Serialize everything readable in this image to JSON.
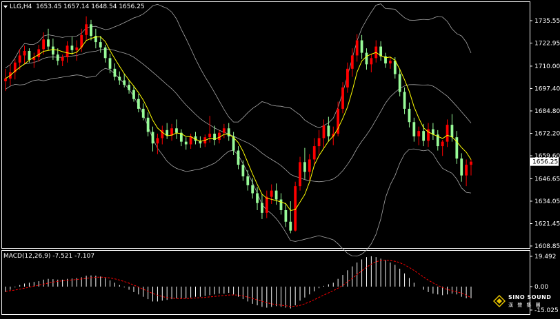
{
  "header": {
    "symbol": "LLG,H4",
    "ohlc": "1653.45 1657.14 1648.54 1656.25"
  },
  "macd_header": {
    "label": "MACD(12,26,9) -7.521 -7.107"
  },
  "price_axis": {
    "ticks": [
      "1735.55",
      "1722.95",
      "1710.00",
      "1697.40",
      "1684.80",
      "1672.20",
      "1659.60",
      "1646.65",
      "1634.05",
      "1621.45",
      "1608.85"
    ],
    "current_price": "1656.25"
  },
  "macd_axis": {
    "ticks": [
      "19.492",
      "0.00",
      "-15.025"
    ]
  },
  "logo": {
    "brand": "SINO SOUND",
    "chinese": "漢 聲 集 團"
  },
  "colors": {
    "background": "#000000",
    "bull_candle": "#ff0000",
    "bear_candle": "#98fb98",
    "ma_line": "#ffff00",
    "bands": "#a8a8a8",
    "macd_hist": "#ffffff",
    "macd_signal": "#ff0000",
    "axis_border": "#ffffff"
  },
  "chart_data": [
    {
      "type": "candlestick",
      "title": "LLG,H4",
      "indicators": [
        "Bollinger Bands",
        "Moving Average"
      ],
      "ylim": [
        1608.85,
        1741.0
      ],
      "ohlc": [
        [
          1701.5,
          1708.5,
          1696.0,
          1703.0
        ],
        [
          1703.0,
          1711.0,
          1699.0,
          1706.5
        ],
        [
          1706.5,
          1714.0,
          1702.5,
          1712.0
        ],
        [
          1712.0,
          1719.5,
          1708.0,
          1716.0
        ],
        [
          1716.0,
          1721.5,
          1711.5,
          1718.5
        ],
        [
          1718.5,
          1720.0,
          1712.0,
          1713.5
        ],
        [
          1713.5,
          1717.5,
          1709.0,
          1715.0
        ],
        [
          1715.0,
          1722.0,
          1712.5,
          1719.5
        ],
        [
          1719.5,
          1729.0,
          1716.5,
          1725.0
        ],
        [
          1725.0,
          1731.0,
          1719.0,
          1721.0
        ],
        [
          1721.0,
          1725.5,
          1713.5,
          1716.5
        ],
        [
          1716.5,
          1720.0,
          1710.5,
          1713.0
        ],
        [
          1713.0,
          1716.5,
          1710.0,
          1715.0
        ],
        [
          1715.0,
          1724.0,
          1712.0,
          1721.5
        ],
        [
          1721.5,
          1726.5,
          1716.5,
          1719.0
        ],
        [
          1719.0,
          1724.5,
          1713.0,
          1720.5
        ],
        [
          1720.5,
          1731.0,
          1718.0,
          1727.5
        ],
        [
          1727.5,
          1738.0,
          1724.5,
          1733.5
        ],
        [
          1733.5,
          1736.0,
          1724.5,
          1727.0
        ],
        [
          1727.0,
          1731.0,
          1720.0,
          1723.5
        ],
        [
          1723.5,
          1727.0,
          1717.5,
          1720.5
        ],
        [
          1720.5,
          1722.0,
          1712.0,
          1714.5
        ],
        [
          1714.5,
          1717.0,
          1706.0,
          1708.5
        ],
        [
          1708.5,
          1711.5,
          1702.0,
          1704.0
        ],
        [
          1704.0,
          1707.0,
          1699.5,
          1702.0
        ],
        [
          1702.0,
          1705.5,
          1698.0,
          1699.5
        ],
        [
          1699.5,
          1702.0,
          1694.5,
          1696.5
        ],
        [
          1696.5,
          1699.0,
          1690.0,
          1691.5
        ],
        [
          1691.5,
          1694.5,
          1684.0,
          1686.0
        ],
        [
          1686.0,
          1689.0,
          1679.5,
          1681.0
        ],
        [
          1681.0,
          1684.0,
          1670.5,
          1673.0
        ],
        [
          1673.0,
          1676.0,
          1662.0,
          1666.5
        ],
        [
          1666.5,
          1672.0,
          1660.5,
          1669.5
        ],
        [
          1669.5,
          1676.5,
          1666.0,
          1674.0
        ],
        [
          1674.0,
          1678.0,
          1669.0,
          1671.0
        ],
        [
          1671.0,
          1677.5,
          1668.0,
          1675.0
        ],
        [
          1675.0,
          1680.0,
          1669.0,
          1672.5
        ],
        [
          1672.5,
          1674.5,
          1665.0,
          1667.5
        ],
        [
          1667.5,
          1670.0,
          1663.0,
          1666.0
        ],
        [
          1666.0,
          1672.0,
          1663.5,
          1670.5
        ],
        [
          1670.5,
          1673.0,
          1666.0,
          1668.0
        ],
        [
          1668.0,
          1670.5,
          1664.0,
          1666.5
        ],
        [
          1666.5,
          1671.5,
          1664.5,
          1670.0
        ],
        [
          1670.0,
          1682.0,
          1667.0,
          1672.0
        ],
        [
          1672.0,
          1676.5,
          1665.5,
          1668.5
        ],
        [
          1668.5,
          1674.0,
          1666.5,
          1672.5
        ],
        [
          1672.5,
          1677.5,
          1669.5,
          1675.0
        ],
        [
          1675.0,
          1678.0,
          1668.0,
          1670.5
        ],
        [
          1670.5,
          1673.0,
          1660.0,
          1662.5
        ],
        [
          1662.5,
          1665.0,
          1652.0,
          1654.5
        ],
        [
          1654.5,
          1657.0,
          1645.5,
          1648.0
        ],
        [
          1648.0,
          1651.5,
          1640.0,
          1643.0
        ],
        [
          1643.0,
          1647.0,
          1635.5,
          1638.5
        ],
        [
          1638.5,
          1642.0,
          1629.0,
          1633.0
        ],
        [
          1633.0,
          1638.0,
          1624.0,
          1627.5
        ],
        [
          1627.5,
          1640.0,
          1624.5,
          1636.5
        ],
        [
          1636.5,
          1643.5,
          1632.5,
          1640.0
        ],
        [
          1640.0,
          1644.0,
          1632.0,
          1635.0
        ],
        [
          1635.0,
          1638.5,
          1626.5,
          1629.0
        ],
        [
          1629.0,
          1633.0,
          1619.5,
          1622.5
        ],
        [
          1622.5,
          1634.0,
          1616.0,
          1617.5
        ],
        [
          1617.5,
          1645.0,
          1617.0,
          1642.5
        ],
        [
          1642.5,
          1659.0,
          1640.0,
          1656.0
        ],
        [
          1656.0,
          1664.0,
          1646.5,
          1650.5
        ],
        [
          1650.5,
          1660.5,
          1646.0,
          1657.5
        ],
        [
          1657.5,
          1669.5,
          1654.0,
          1665.0
        ],
        [
          1665.0,
          1674.0,
          1660.5,
          1669.5
        ],
        [
          1669.5,
          1680.0,
          1664.0,
          1676.5
        ],
        [
          1676.5,
          1681.5,
          1667.5,
          1670.5
        ],
        [
          1670.5,
          1676.0,
          1665.5,
          1672.0
        ],
        [
          1672.0,
          1690.0,
          1670.5,
          1686.0
        ],
        [
          1686.0,
          1701.0,
          1683.5,
          1698.0
        ],
        [
          1698.0,
          1712.0,
          1695.0,
          1708.5
        ],
        [
          1708.5,
          1720.0,
          1704.0,
          1716.0
        ],
        [
          1716.0,
          1728.0,
          1712.5,
          1724.5
        ],
        [
          1724.5,
          1727.5,
          1714.0,
          1717.5
        ],
        [
          1717.5,
          1720.0,
          1708.0,
          1711.0
        ],
        [
          1711.0,
          1717.0,
          1706.5,
          1714.5
        ],
        [
          1714.5,
          1724.5,
          1712.0,
          1721.0
        ],
        [
          1721.0,
          1724.0,
          1713.0,
          1715.5
        ],
        [
          1715.5,
          1717.5,
          1709.0,
          1711.5
        ],
        [
          1711.5,
          1715.0,
          1708.5,
          1713.0
        ],
        [
          1713.0,
          1715.0,
          1703.0,
          1705.5
        ],
        [
          1705.5,
          1708.5,
          1693.0,
          1695.5
        ],
        [
          1695.5,
          1698.0,
          1683.0,
          1686.0
        ],
        [
          1686.0,
          1689.5,
          1675.5,
          1678.5
        ],
        [
          1678.5,
          1681.0,
          1667.5,
          1670.5
        ],
        [
          1670.5,
          1676.0,
          1665.5,
          1673.5
        ],
        [
          1673.5,
          1677.5,
          1665.0,
          1668.0
        ],
        [
          1668.0,
          1678.0,
          1664.5,
          1674.5
        ],
        [
          1674.5,
          1678.0,
          1668.5,
          1671.5
        ],
        [
          1671.5,
          1674.0,
          1662.5,
          1665.0
        ],
        [
          1665.0,
          1668.5,
          1659.5,
          1667.5
        ],
        [
          1667.5,
          1680.0,
          1664.5,
          1677.0
        ],
        [
          1677.0,
          1683.0,
          1667.5,
          1670.0
        ],
        [
          1670.0,
          1673.5,
          1655.0,
          1658.0
        ],
        [
          1658.0,
          1661.0,
          1645.0,
          1648.5
        ],
        [
          1648.5,
          1657.5,
          1642.5,
          1654.5
        ],
        [
          1654.5,
          1657.5,
          1648.5,
          1656.25
        ]
      ]
    },
    {
      "type": "bar",
      "title": "MACD(12,26,9) -7.521 -7.107",
      "ylim": [
        -15.025,
        19.492
      ],
      "histogram": [
        -3.5,
        -2.0,
        -0.5,
        1.0,
        2.0,
        2.5,
        3.0,
        3.5,
        4.5,
        5.0,
        4.8,
        4.5,
        4.5,
        5.0,
        5.2,
        5.5,
        6.0,
        7.0,
        7.2,
        7.0,
        6.5,
        5.5,
        4.0,
        2.5,
        1.0,
        -0.5,
        -2.0,
        -3.5,
        -5.0,
        -6.5,
        -8.0,
        -9.5,
        -9.5,
        -9.0,
        -8.5,
        -8.0,
        -7.5,
        -7.5,
        -7.5,
        -7.0,
        -6.5,
        -6.5,
        -6.0,
        -5.5,
        -5.0,
        -4.5,
        -4.5,
        -4.0,
        -5.0,
        -6.5,
        -8.0,
        -9.5,
        -11.0,
        -12.0,
        -13.0,
        -13.5,
        -13.0,
        -12.5,
        -13.0,
        -13.5,
        -14.0,
        -12.0,
        -9.0,
        -7.0,
        -5.0,
        -3.0,
        -1.0,
        0.5,
        1.5,
        2.5,
        5.0,
        7.5,
        10.5,
        13.0,
        15.5,
        17.5,
        19.0,
        19.5,
        19.0,
        18.0,
        17.0,
        15.5,
        14.0,
        11.5,
        8.5,
        5.5,
        2.5,
        0.0,
        -2.0,
        -3.5,
        -4.5,
        -5.0,
        -5.5,
        -5.0,
        -4.5,
        -5.0,
        -6.5,
        -7.5,
        -7.521
      ],
      "signal_line": [
        -3.0,
        -2.6,
        -2.2,
        -1.6,
        -1.0,
        -0.4,
        0.3,
        0.9,
        1.6,
        2.3,
        2.9,
        3.4,
        3.7,
        4.0,
        4.3,
        4.6,
        4.9,
        5.3,
        5.7,
        6.0,
        6.1,
        6.0,
        5.6,
        5.0,
        4.2,
        3.3,
        2.2,
        1.0,
        -0.3,
        -1.7,
        -3.0,
        -4.4,
        -5.5,
        -6.4,
        -7.0,
        -7.4,
        -7.6,
        -7.6,
        -7.6,
        -7.5,
        -7.3,
        -7.1,
        -6.9,
        -6.6,
        -6.3,
        -6.0,
        -5.7,
        -5.4,
        -5.3,
        -5.5,
        -6.0,
        -6.7,
        -7.6,
        -8.5,
        -9.4,
        -10.3,
        -11.0,
        -11.5,
        -11.9,
        -12.3,
        -12.7,
        -12.6,
        -12.0,
        -11.0,
        -9.8,
        -8.4,
        -6.9,
        -5.4,
        -4.0,
        -2.6,
        -1.0,
        0.8,
        3.0,
        5.3,
        7.8,
        10.2,
        12.5,
        14.5,
        16.0,
        16.8,
        17.0,
        16.8,
        16.3,
        15.4,
        14.0,
        12.3,
        10.4,
        8.3,
        6.2,
        4.2,
        2.4,
        0.8,
        -0.6,
        -1.8,
        -2.6,
        -3.3,
        -4.2,
        -5.5,
        -7.107
      ]
    }
  ]
}
